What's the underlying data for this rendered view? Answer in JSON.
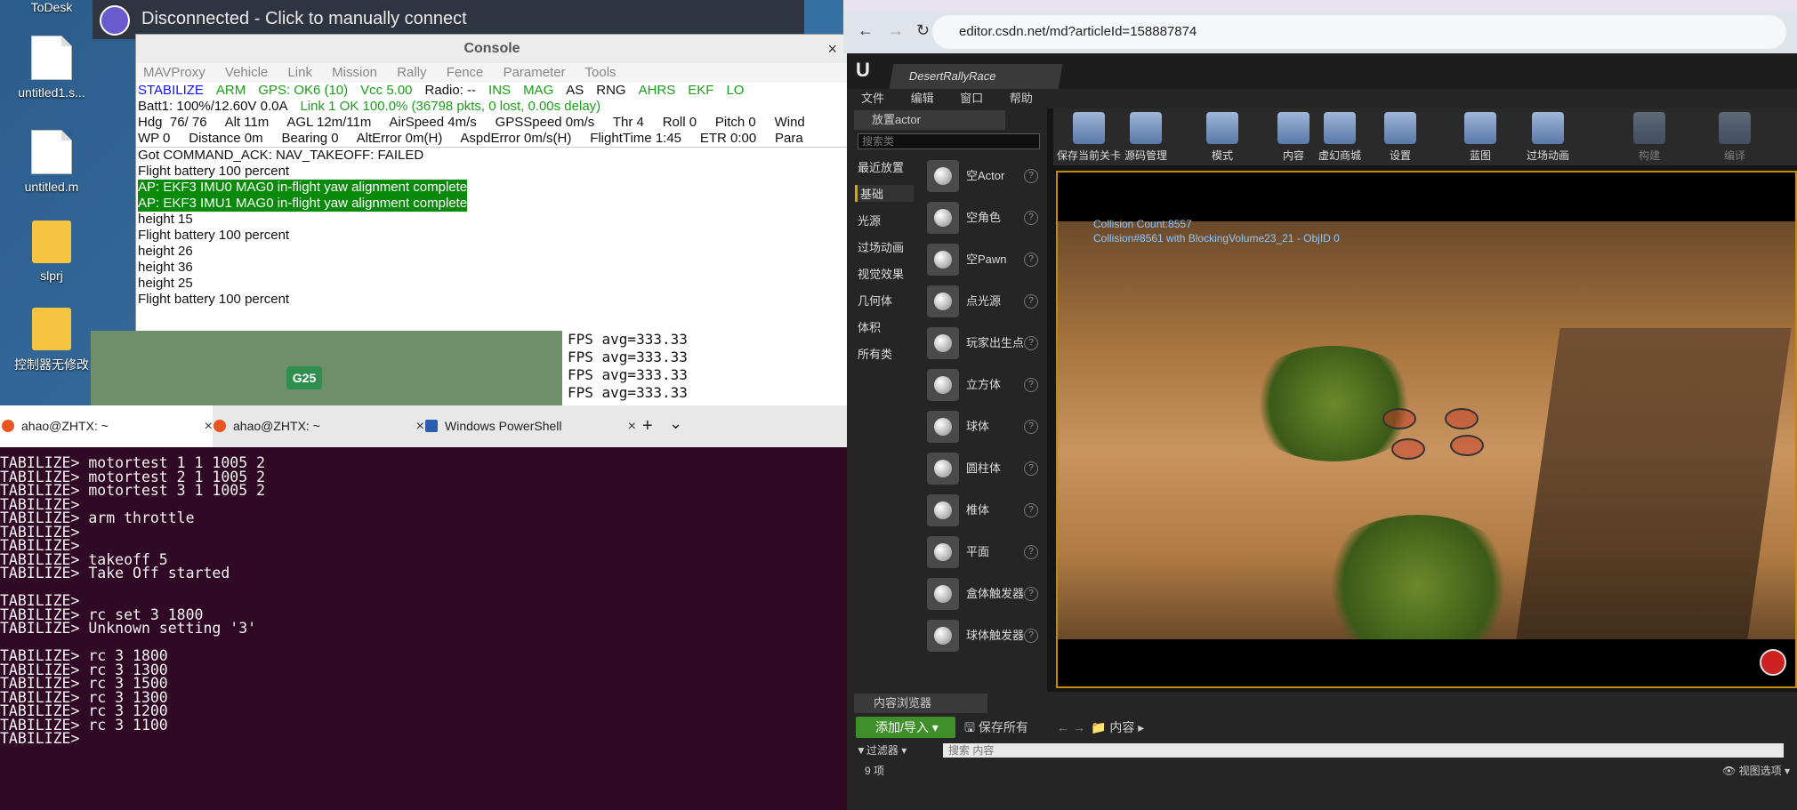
{
  "desktop": {
    "icons": [
      {
        "label": "ToDesk"
      },
      {
        "label": "untitled1.s..."
      },
      {
        "label": "untitled.m"
      },
      {
        "label": "slprj"
      },
      {
        "label": "控制器无修改"
      }
    ]
  },
  "vpn": {
    "status": "Disconnected - Click to manually connect"
  },
  "console": {
    "title": "Console",
    "menu": [
      "MAVProxy",
      "Vehicle",
      "Link",
      "Mission",
      "Rally",
      "Fence",
      "Parameter",
      "Tools"
    ],
    "status_row1": [
      {
        "t": "STABILIZE",
        "c": "blue"
      },
      {
        "t": "ARM",
        "c": "green"
      },
      {
        "t": "GPS: OK6 (10)",
        "c": "green"
      },
      {
        "t": "Vcc 5.00",
        "c": "green"
      },
      {
        "t": "Radio: --",
        "c": "black"
      },
      {
        "t": "INS",
        "c": "green"
      },
      {
        "t": "MAG",
        "c": "green"
      },
      {
        "t": "AS",
        "c": "black"
      },
      {
        "t": "RNG",
        "c": "black"
      },
      {
        "t": "AHRS",
        "c": "green"
      },
      {
        "t": "EKF",
        "c": "green"
      },
      {
        "t": "LO",
        "c": "green"
      }
    ],
    "status_row2": [
      {
        "t": "Batt1: 100%/12.60V 0.0A",
        "c": "black"
      },
      {
        "t": "Link 1 OK 100.0% (36798 pkts, 0 lost, 0.00s delay)",
        "c": "green"
      }
    ],
    "status_row3": "Hdg  76/ 76     Alt 11m     AGL 12m/11m     AirSpeed 4m/s     GPSSpeed 0m/s     Thr 4     Roll 0     Pitch 0     Wind",
    "status_row4": "WP 0     Distance 0m     Bearing 0     AltError 0m(H)     AspdError 0m/s(H)     FlightTime 1:45     ETR 0:00     Para",
    "log": [
      {
        "t": "Got COMMAND_ACK: NAV_TAKEOFF: FAILED",
        "hl": false
      },
      {
        "t": "Flight battery 100 percent",
        "hl": false
      },
      {
        "t": "AP: EKF3 IMU0 MAG0 in-flight yaw alignment complete",
        "hl": true
      },
      {
        "t": "AP: EKF3 IMU1 MAG0 in-flight yaw alignment complete",
        "hl": true
      },
      {
        "t": "height 15",
        "hl": false
      },
      {
        "t": "Flight battery 100 percent",
        "hl": false
      },
      {
        "t": "height 26",
        "hl": false
      },
      {
        "t": "height 36",
        "hl": false
      },
      {
        "t": "height 25",
        "hl": false
      },
      {
        "t": "Flight battery 100 percent",
        "hl": false
      }
    ]
  },
  "map": {
    "road_label": "G25"
  },
  "fps": [
    "FPS avg=333.33",
    "FPS avg=333.33",
    "FPS avg=333.33",
    "FPS avg=333.33"
  ],
  "terminal": {
    "tabs": [
      {
        "label": "ahao@ZHTX: ~"
      },
      {
        "label": "ahao@ZHTX: ~"
      },
      {
        "label": "Windows PowerShell"
      }
    ],
    "new_tab": "+",
    "dropdown": "⌄",
    "lines": [
      "TABILIZE> motortest 1 1 1005 2",
      "TABILIZE> motortest 2 1 1005 2",
      "TABILIZE> motortest 3 1 1005 2",
      "TABILIZE>",
      "TABILIZE> arm throttle",
      "TABILIZE>",
      "TABILIZE>",
      "TABILIZE> takeoff 5",
      "TABILIZE> Take Off started",
      "",
      "TABILIZE>",
      "TABILIZE> rc set 3 1800",
      "TABILIZE> Unknown setting '3'",
      "",
      "TABILIZE> rc 3 1800",
      "TABILIZE> rc 3 1300",
      "TABILIZE> rc 3 1500",
      "TABILIZE> rc 3 1300",
      "TABILIZE> rc 3 1200",
      "TABILIZE> rc 3 1100",
      "TABILIZE>"
    ]
  },
  "browser": {
    "url": "editor.csdn.net/md?articleId=158887874"
  },
  "ue": {
    "project_tab": "DesertRallyRace",
    "menu": [
      "文件",
      "编辑",
      "窗口",
      "帮助"
    ],
    "place_actor_tab": "放置actor",
    "search_placeholder": "搜索类",
    "categories": [
      "最近放置",
      "基础",
      "光源",
      "过场动画",
      "视觉效果",
      "几何体",
      "体积",
      "所有类"
    ],
    "selected_category": "基础",
    "items": [
      "空Actor",
      "空角色",
      "空Pawn",
      "点光源",
      "玩家出生点",
      "立方体",
      "球体",
      "圆柱体",
      "椎体",
      "平面",
      "盒体触发器",
      "球体触发器"
    ],
    "toolbar": [
      "保存当前关卡",
      "源码管理",
      "模式",
      "内容",
      "虚幻商城",
      "设置",
      "蓝图",
      "过场动画",
      "构建",
      "编译"
    ],
    "overlay": [
      "Collision Count:8557",
      "Collision#8561 with BlockingVolume23_21 - ObjID 0"
    ],
    "content_browser": {
      "tab": "内容浏览器",
      "add_import": "添加/导入",
      "save_all": "保存所有",
      "path": "内容",
      "filter": "过滤器",
      "search_placeholder": "搜索 内容",
      "count": "9 项",
      "view_options": "视图选项"
    }
  }
}
